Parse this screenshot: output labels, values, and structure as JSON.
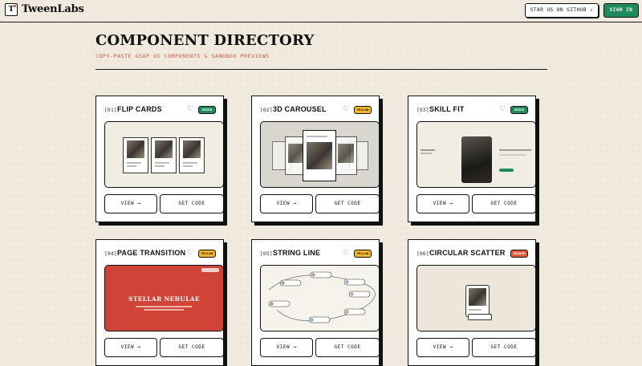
{
  "header": {
    "brand": "TweenLabs",
    "logo_letter": "T",
    "github_label": "STAR US ON GITHUB ↗",
    "signin_label": "SIGN IN"
  },
  "page": {
    "title": "COMPONENT DIRECTORY",
    "subtitle": "COPY-PASTE GSAP UI COMPONENTS & SANDBOX PREVIEWS"
  },
  "common": {
    "view_label": "VIEW ⟶",
    "code_label": "GET CODE",
    "heart_icon": "heart-icon"
  },
  "cards": [
    {
      "num": "[01]",
      "title": "FLIP CARDS",
      "badge": "GREEN",
      "badge_color": "#1f8a5b"
    },
    {
      "num": "[02]",
      "title": "3D CAROUSEL",
      "badge": "YELLOW",
      "badge_color": "#f2b72c"
    },
    {
      "num": "[03]",
      "title": "SKILL FIT",
      "badge": "GREEN",
      "badge_color": "#1f8a5b"
    },
    {
      "num": "[04]",
      "title": "PAGE TRANSITION",
      "badge": "YELLOW",
      "badge_color": "#f2b72c"
    },
    {
      "num": "[05]",
      "title": "STRING LINE",
      "badge": "YELLOW",
      "badge_color": "#f2b72c"
    },
    {
      "num": "[06]",
      "title": "CIRCULAR SCATTER",
      "badge": "ORANGE",
      "badge_color": "#e05a3c"
    }
  ],
  "previews": {
    "page_transition_heading": "STELLAR NEBULAE"
  }
}
